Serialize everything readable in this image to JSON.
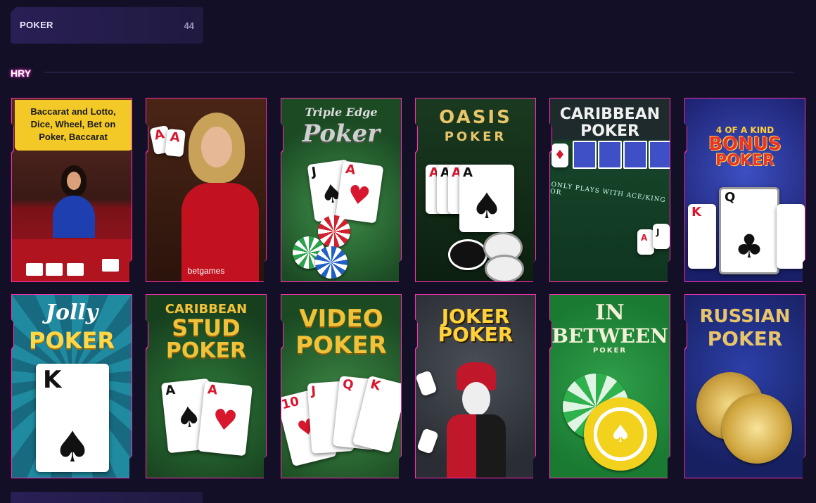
{
  "category": {
    "label": "POKER",
    "count": "44"
  },
  "section": {
    "title": "HRY"
  },
  "colors": {
    "accent": "#ff2fb3",
    "background": "#120f26"
  },
  "games": [
    {
      "id": "baccarat-lotto",
      "banner": "Baccarat and Lotto, Dice, Wheel, Bet on Poker, Baccarat"
    },
    {
      "id": "betgames-poker",
      "provider": "betgames"
    },
    {
      "id": "triple-edge",
      "title1": "Triple Edge",
      "title2": "Poker"
    },
    {
      "id": "oasis",
      "title1": "OASIS",
      "title2": "POKER"
    },
    {
      "id": "caribbean",
      "title1": "CARIBBEAN",
      "title2": "POKER",
      "felt": "ONLY PLAYS WITH ACE/KING OR"
    },
    {
      "id": "bonus-poker",
      "title1": "4 OF A KIND",
      "title2": "BONUS",
      "title3": "POKER"
    },
    {
      "id": "jolly",
      "title1": "Jolly",
      "title2": "POKER"
    },
    {
      "id": "caribbean-stud",
      "title1": "CARIBBEAN",
      "title2": "STUD",
      "title3": "POKER"
    },
    {
      "id": "video-poker",
      "title1": "VIDEO",
      "title2": "POKER"
    },
    {
      "id": "joker-poker",
      "title1": "JOKER",
      "title2": "POKER"
    },
    {
      "id": "in-between",
      "title1": "IN",
      "title2": "BETWEEN",
      "title3": "POKER"
    },
    {
      "id": "russian",
      "title1": "RUSSIAN",
      "title2": "POKER"
    }
  ],
  "cards": {
    "ace": "A",
    "king": "K",
    "queen": "Q",
    "jack": "J",
    "ten": "10",
    "spade": "♠",
    "heart": "♥",
    "club": "♣",
    "diamond": "♦"
  }
}
